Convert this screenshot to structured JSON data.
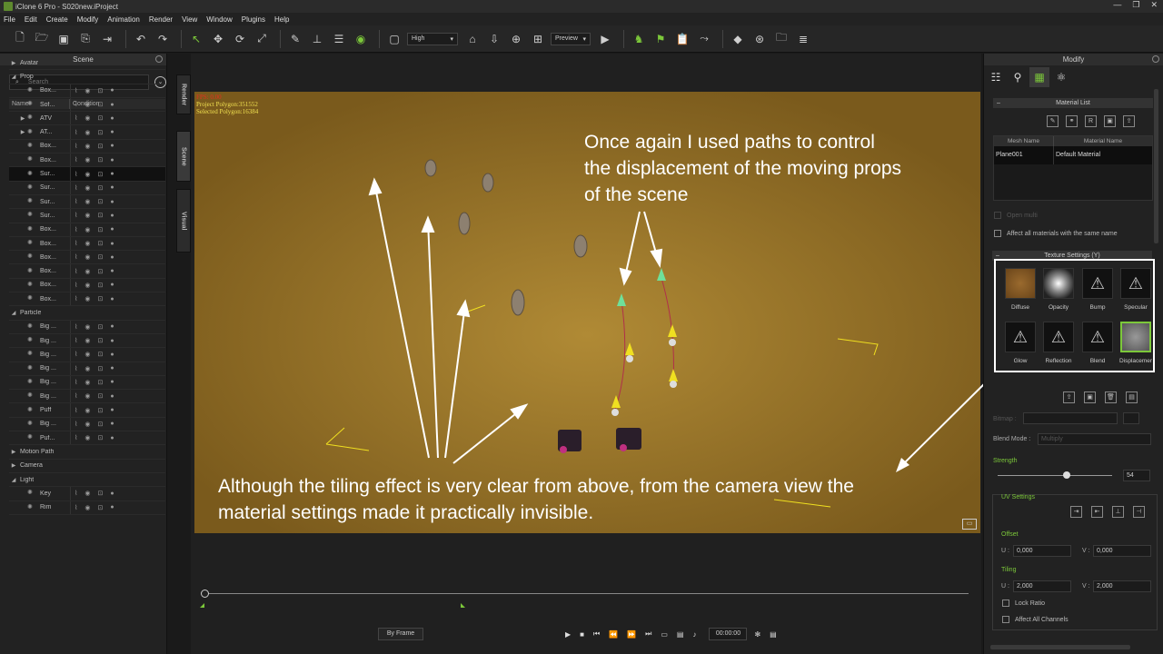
{
  "window": {
    "title": "iClone 6 Pro - S020new.iProject",
    "controls": [
      "—",
      "❐",
      "✕"
    ]
  },
  "menu": [
    "File",
    "Edit",
    "Create",
    "Modify",
    "Animation",
    "Render",
    "View",
    "Window",
    "Plugins",
    "Help"
  ],
  "toolbar": {
    "quality": "High",
    "preview": "Preview"
  },
  "scene_panel": {
    "title": "Scene",
    "search_placeholder": "Search",
    "col_name": "Name",
    "col_condition": "Condition",
    "rows": [
      {
        "label": "Avatar",
        "type": "cat",
        "exp": "▶"
      },
      {
        "label": "Prop",
        "type": "cat",
        "exp": "◢"
      },
      {
        "label": "Box...",
        "type": "item"
      },
      {
        "label": "Sof...",
        "type": "item"
      },
      {
        "label": "ATV",
        "type": "item",
        "exp": "▶"
      },
      {
        "label": "AT...",
        "type": "item",
        "exp": "▶"
      },
      {
        "label": "Box...",
        "type": "item"
      },
      {
        "label": "Box...",
        "type": "item"
      },
      {
        "label": "Sur...",
        "type": "item",
        "sel": true
      },
      {
        "label": "Sur...",
        "type": "item"
      },
      {
        "label": "Sur...",
        "type": "item"
      },
      {
        "label": "Sur...",
        "type": "item"
      },
      {
        "label": "Box...",
        "type": "item"
      },
      {
        "label": "Box...",
        "type": "item"
      },
      {
        "label": "Box...",
        "type": "item"
      },
      {
        "label": "Box...",
        "type": "item"
      },
      {
        "label": "Box...",
        "type": "item"
      },
      {
        "label": "Box...",
        "type": "item"
      },
      {
        "label": "Particle",
        "type": "cat",
        "exp": "◢"
      },
      {
        "label": "Big ...",
        "type": "item"
      },
      {
        "label": "Big ...",
        "type": "item"
      },
      {
        "label": "Big ...",
        "type": "item"
      },
      {
        "label": "Big ...",
        "type": "item"
      },
      {
        "label": "Big ...",
        "type": "item"
      },
      {
        "label": "Big ...",
        "type": "item"
      },
      {
        "label": "Puff",
        "type": "item"
      },
      {
        "label": "Big ...",
        "type": "item"
      },
      {
        "label": "Puf...",
        "type": "item"
      },
      {
        "label": "Motion Path",
        "type": "cat",
        "exp": "▶"
      },
      {
        "label": "Camera",
        "type": "cat",
        "exp": "▶"
      },
      {
        "label": "Light",
        "type": "cat",
        "exp": "◢"
      },
      {
        "label": "Key",
        "type": "item"
      },
      {
        "label": "Rim",
        "type": "item"
      }
    ]
  },
  "side_tabs": [
    "Render",
    "Scene",
    "Visual"
  ],
  "viewport": {
    "fps": "FPS: 0.00",
    "project_polygon": "Project Polygon:351552",
    "selected_polygon": "Selected Polygon:16384",
    "annotation_top": [
      "Once again I used paths to control",
      "the displacement of the moving props",
      "of the scene"
    ],
    "annotation_bottom": [
      "Although the tiling effect is very clear from above, from the camera view the",
      "material settings made it practically invisible."
    ]
  },
  "playback": {
    "mode": "By Frame",
    "time": "00:00:00"
  },
  "modify_panel": {
    "title": "Modify",
    "material_list_title": "Material List",
    "mesh_name_header": "Mesh Name",
    "material_name_header": "Material Name",
    "mesh_name": "Plane001",
    "material_name": "Default Material",
    "open_multi": "Open multi",
    "affect_all": "Affect all materials with the same name",
    "texture_settings_title": "Texture Settings  (Y)",
    "textures": [
      "Diffuse",
      "Opacity",
      "Bump",
      "Specular",
      "Glow",
      "Reflection",
      "Blend",
      "Displacemer"
    ],
    "bitmap_label": "Bitmap :",
    "blend_mode_label": "Blend Mode :",
    "blend_mode_value": "Multiply",
    "strength_label": "Strength",
    "strength_value": "54",
    "uv_settings_title": "UV Settings",
    "offset_label": "Offset",
    "tiling_label": "Tiling",
    "u_label": "U :",
    "v_label": "V :",
    "offset_u": "0,000",
    "offset_v": "0,000",
    "tiling_u": "2,000",
    "tiling_v": "2,000",
    "lock_ratio": "Lock Ratio",
    "affect_all_channels": "Affect All Channels"
  }
}
